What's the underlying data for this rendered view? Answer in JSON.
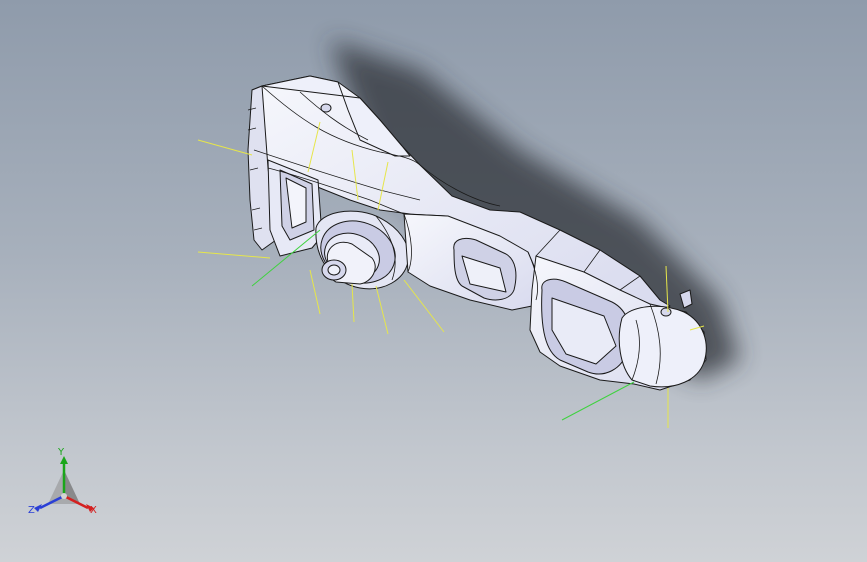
{
  "viewport": {
    "background_top": "#8f9bab",
    "background_bottom": "#cfd2d6"
  },
  "part": {
    "body_color": "#eceef8",
    "shade_color": "#c9cbe4",
    "edge_color": "#1a1a1a",
    "shadow_color": "#2e3038",
    "construction_line_color": "#e6e64a",
    "axis_line_color": "#3fd23f"
  },
  "triad": {
    "x_label": "X",
    "y_label": "Y",
    "z_label": "Z",
    "x_color": "#d42020",
    "y_color": "#1aa61a",
    "z_color": "#2a3fd6"
  }
}
